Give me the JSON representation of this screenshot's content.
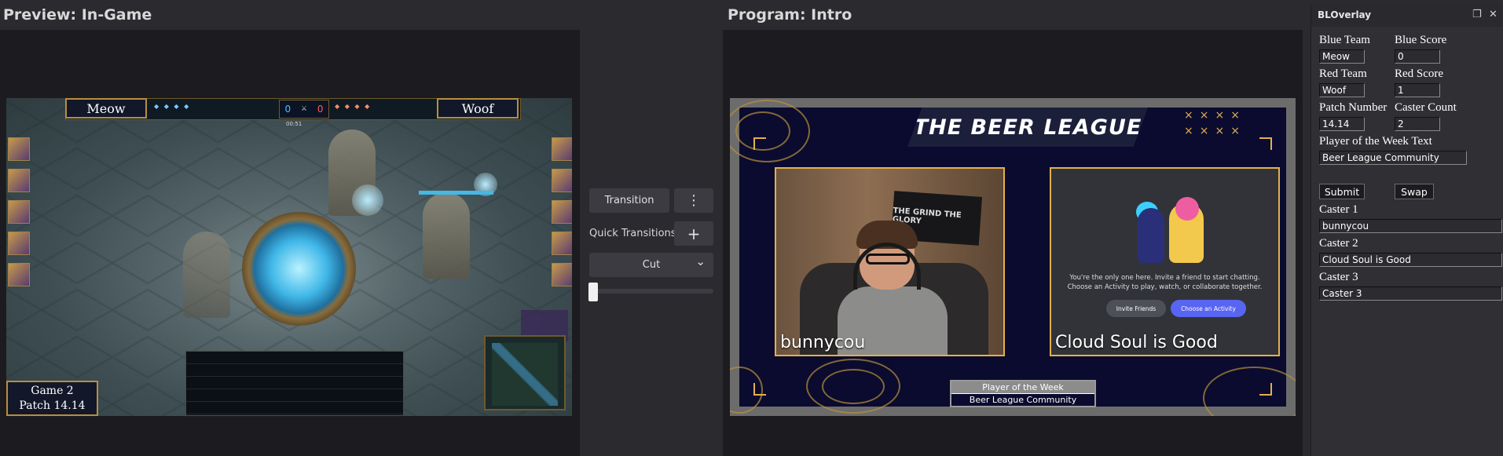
{
  "preview": {
    "title": "Preview: In-Game",
    "blue_team": "Meow",
    "red_team": "Woof",
    "blue_kills": "0",
    "red_kills": "0",
    "timer": "00:51",
    "game_line": "Game 2",
    "patch_line": "Patch 14.14"
  },
  "program": {
    "title": "Program: Intro",
    "banner": "THE BEER LEAGUE",
    "xmarks": "××××\n××××",
    "flag_text": "THE GRIND THE GLORY",
    "caster_left": "bunnycou",
    "caster_right": "Cloud Soul is Good",
    "discord_line1": "You're the only one here. Invite a friend to start chatting.",
    "discord_line2": "Choose an Activity to play, watch, or collaborate together.",
    "invite_btn": "Invite Friends",
    "activity_btn": "Choose an Activity",
    "potw_title": "Player of the Week",
    "potw_value": "Beer League Community",
    "colors": {
      "accent": "#e3b04b",
      "navy": "#0a0b2e"
    }
  },
  "transitions": {
    "transition_label": "Transition",
    "more_icon": "⋮",
    "quick_label": "Quick Transitions",
    "add_icon": "+",
    "cut_label": "Cut",
    "chevron": "⌄"
  },
  "panel": {
    "title": "BLOverlay",
    "float_icon": "❐",
    "close_icon": "✕",
    "blue_team_label": "Blue Team",
    "blue_team_value": "Meow",
    "blue_score_label": "Blue Score",
    "blue_score_value": "0",
    "red_team_label": "Red Team",
    "red_team_value": "Woof",
    "red_score_label": "Red Score",
    "red_score_value": "1",
    "patch_label": "Patch Number",
    "patch_value": "14.14",
    "caster_count_label": "Caster Count",
    "caster_count_value": "2",
    "potw_label": "Player of the Week Text",
    "potw_value": "Beer League Community",
    "submit_label": "Submit",
    "swap_label": "Swap",
    "caster1_label": "Caster 1",
    "caster1_value": "bunnycou",
    "caster2_label": "Caster 2",
    "caster2_value": "Cloud Soul is Good",
    "caster3_label": "Caster 3",
    "caster3_value": "Caster 3"
  }
}
